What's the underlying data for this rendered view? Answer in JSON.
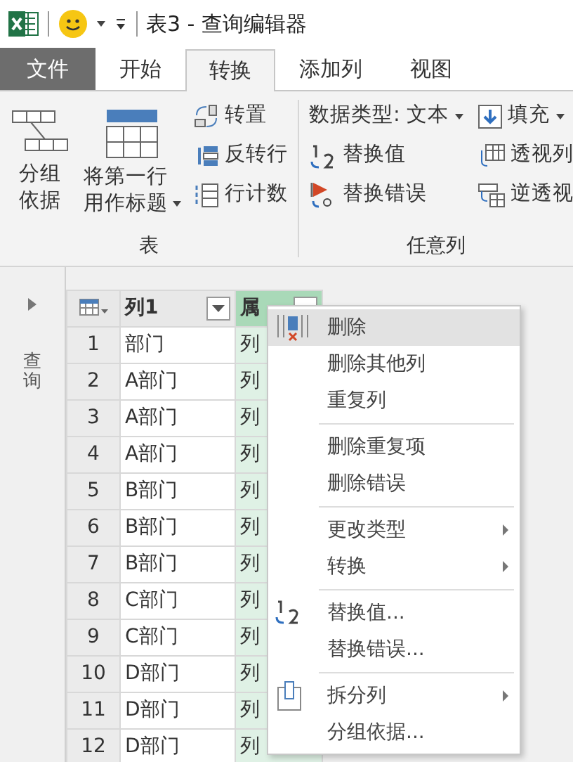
{
  "window": {
    "title": "表3 - 查询编辑器"
  },
  "tabs": [
    {
      "label": "文件",
      "kind": "file",
      "selected": false
    },
    {
      "label": "开始",
      "kind": "tab",
      "selected": false
    },
    {
      "label": "转换",
      "kind": "tab",
      "selected": true
    },
    {
      "label": "添加列",
      "kind": "tab",
      "selected": false
    },
    {
      "label": "视图",
      "kind": "tab",
      "selected": false
    }
  ],
  "ribbon_groups": [
    {
      "label": "表",
      "columns": [
        [
          {
            "label": "分组依据",
            "kind": "large",
            "dropdown": false
          }
        ],
        [
          {
            "label": "将第一行用作标题",
            "kind": "large",
            "dropdown": true
          }
        ],
        [
          {
            "label": "转置",
            "kind": "small",
            "dropdown": false
          },
          {
            "label": "反转行",
            "kind": "small",
            "dropdown": false
          },
          {
            "label": "行计数",
            "kind": "small",
            "dropdown": false
          }
        ]
      ]
    },
    {
      "label": "任意列",
      "columns": [
        [
          {
            "label": "数据类型: 文本",
            "kind": "text",
            "dropdown": true
          },
          {
            "label": "替换值",
            "kind": "small",
            "dropdown": false
          },
          {
            "label": "替换错误",
            "kind": "small",
            "dropdown": false
          }
        ],
        [
          {
            "label": "填充",
            "kind": "small",
            "dropdown": true
          },
          {
            "label": "透视列",
            "kind": "small",
            "dropdown": false
          },
          {
            "label": "逆透视",
            "kind": "small",
            "dropdown": false
          }
        ]
      ]
    }
  ],
  "queries_pane": {
    "label": "查询",
    "expanded": false
  },
  "table": {
    "columns": [
      {
        "label": "列1",
        "selected": false
      },
      {
        "label": "属",
        "selected": true
      }
    ],
    "rows": [
      {
        "number": "1",
        "cells": [
          "部门",
          "列"
        ]
      },
      {
        "number": "2",
        "cells": [
          "A部门",
          "列"
        ]
      },
      {
        "number": "3",
        "cells": [
          "A部门",
          "列"
        ]
      },
      {
        "number": "4",
        "cells": [
          "A部门",
          "列"
        ]
      },
      {
        "number": "5",
        "cells": [
          "B部门",
          "列"
        ]
      },
      {
        "number": "6",
        "cells": [
          "B部门",
          "列"
        ]
      },
      {
        "number": "7",
        "cells": [
          "B部门",
          "列"
        ]
      },
      {
        "number": "8",
        "cells": [
          "C部门",
          "列"
        ]
      },
      {
        "number": "9",
        "cells": [
          "C部门",
          "列"
        ]
      },
      {
        "number": "10",
        "cells": [
          "D部门",
          "列"
        ]
      },
      {
        "number": "11",
        "cells": [
          "D部门",
          "列"
        ]
      },
      {
        "number": "12",
        "cells": [
          "D部门",
          "列"
        ]
      }
    ]
  },
  "context_menu": [
    {
      "kind": "item",
      "label": "删除",
      "highlighted": true,
      "submenu": false
    },
    {
      "kind": "item",
      "label": "删除其他列",
      "highlighted": false,
      "submenu": false
    },
    {
      "kind": "item",
      "label": "重复列",
      "highlighted": false,
      "submenu": false
    },
    {
      "kind": "separator"
    },
    {
      "kind": "item",
      "label": "删除重复项",
      "highlighted": false,
      "submenu": false
    },
    {
      "kind": "item",
      "label": "删除错误",
      "highlighted": false,
      "submenu": false
    },
    {
      "kind": "separator"
    },
    {
      "kind": "item",
      "label": "更改类型",
      "highlighted": false,
      "submenu": true
    },
    {
      "kind": "item",
      "label": "转换",
      "highlighted": false,
      "submenu": true
    },
    {
      "kind": "separator"
    },
    {
      "kind": "item",
      "label": "替换值...",
      "highlighted": false,
      "submenu": false
    },
    {
      "kind": "item",
      "label": "替换错误...",
      "highlighted": false,
      "submenu": false
    },
    {
      "kind": "separator"
    },
    {
      "kind": "item",
      "label": "拆分列",
      "highlighted": false,
      "submenu": true
    },
    {
      "kind": "item",
      "label": "分组依据...",
      "highlighted": false,
      "submenu": false
    }
  ]
}
